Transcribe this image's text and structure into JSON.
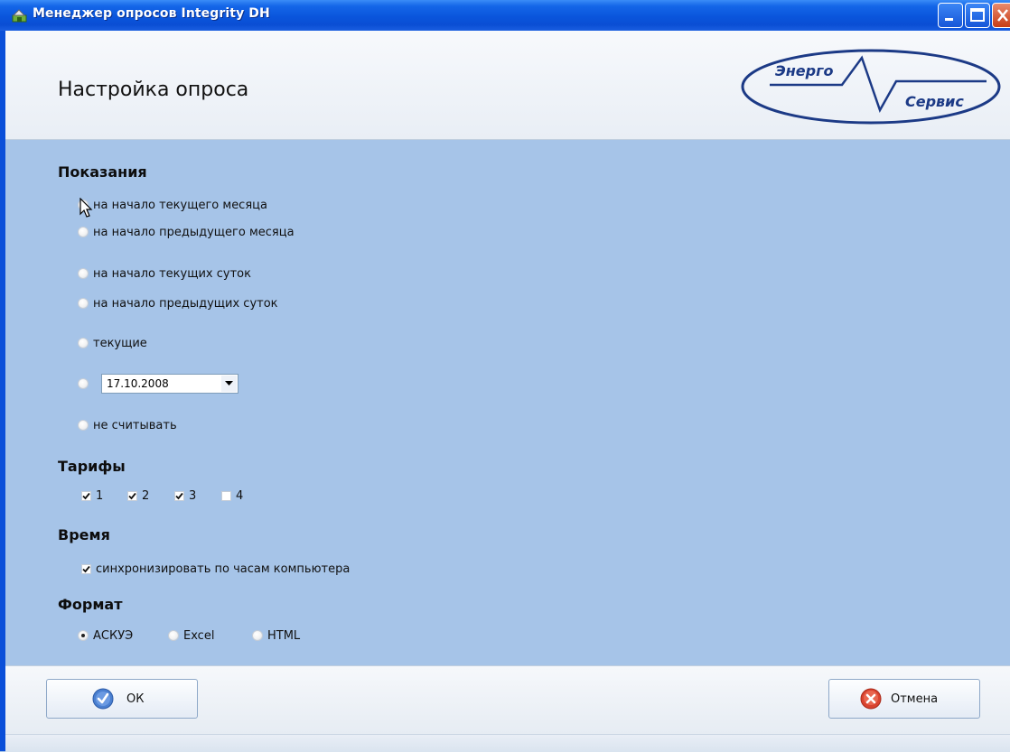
{
  "window": {
    "title": "Менеджер опросов Integrity DH",
    "app_icon": "app-icon",
    "controls": [
      "minimize-icon",
      "maximize-icon",
      "close-icon"
    ]
  },
  "header": {
    "title": "Настройка опроса",
    "logo": {
      "top_text": "Энерго",
      "bottom_text": "Сервис"
    }
  },
  "readings": {
    "section_title": "Показания",
    "options": [
      {
        "label": "на начало текущего месяца",
        "selected": true
      },
      {
        "label": "на начало предыдущего месяца",
        "selected": false
      },
      {
        "label": "на начало текущих суток",
        "selected": false
      },
      {
        "label": "на начало предыдущих суток",
        "selected": false
      },
      {
        "label": "текущие",
        "selected": false
      },
      {
        "label": "",
        "selected": false,
        "date_value": "17.10.2008"
      },
      {
        "label": "не считывать",
        "selected": false
      }
    ]
  },
  "tariffs": {
    "section_title": "Тарифы",
    "items": [
      {
        "label": "1",
        "checked": true
      },
      {
        "label": "2",
        "checked": true
      },
      {
        "label": "3",
        "checked": true
      },
      {
        "label": "4",
        "checked": false
      }
    ]
  },
  "time": {
    "section_title": "Время",
    "sync_label": "синхронизировать по часам компьютера",
    "sync_checked": true
  },
  "format": {
    "section_title": "Формат",
    "options": [
      {
        "label": "АСКУЭ",
        "selected": true
      },
      {
        "label": "Excel",
        "selected": false
      },
      {
        "label": "HTML",
        "selected": false
      }
    ]
  },
  "footer": {
    "ok_label": "ОК",
    "cancel_label": "Отмена"
  },
  "colors": {
    "titlebar": "#0a55dc",
    "main_bg": "#a6c4e8",
    "logo_blue": "#1c3a86"
  }
}
